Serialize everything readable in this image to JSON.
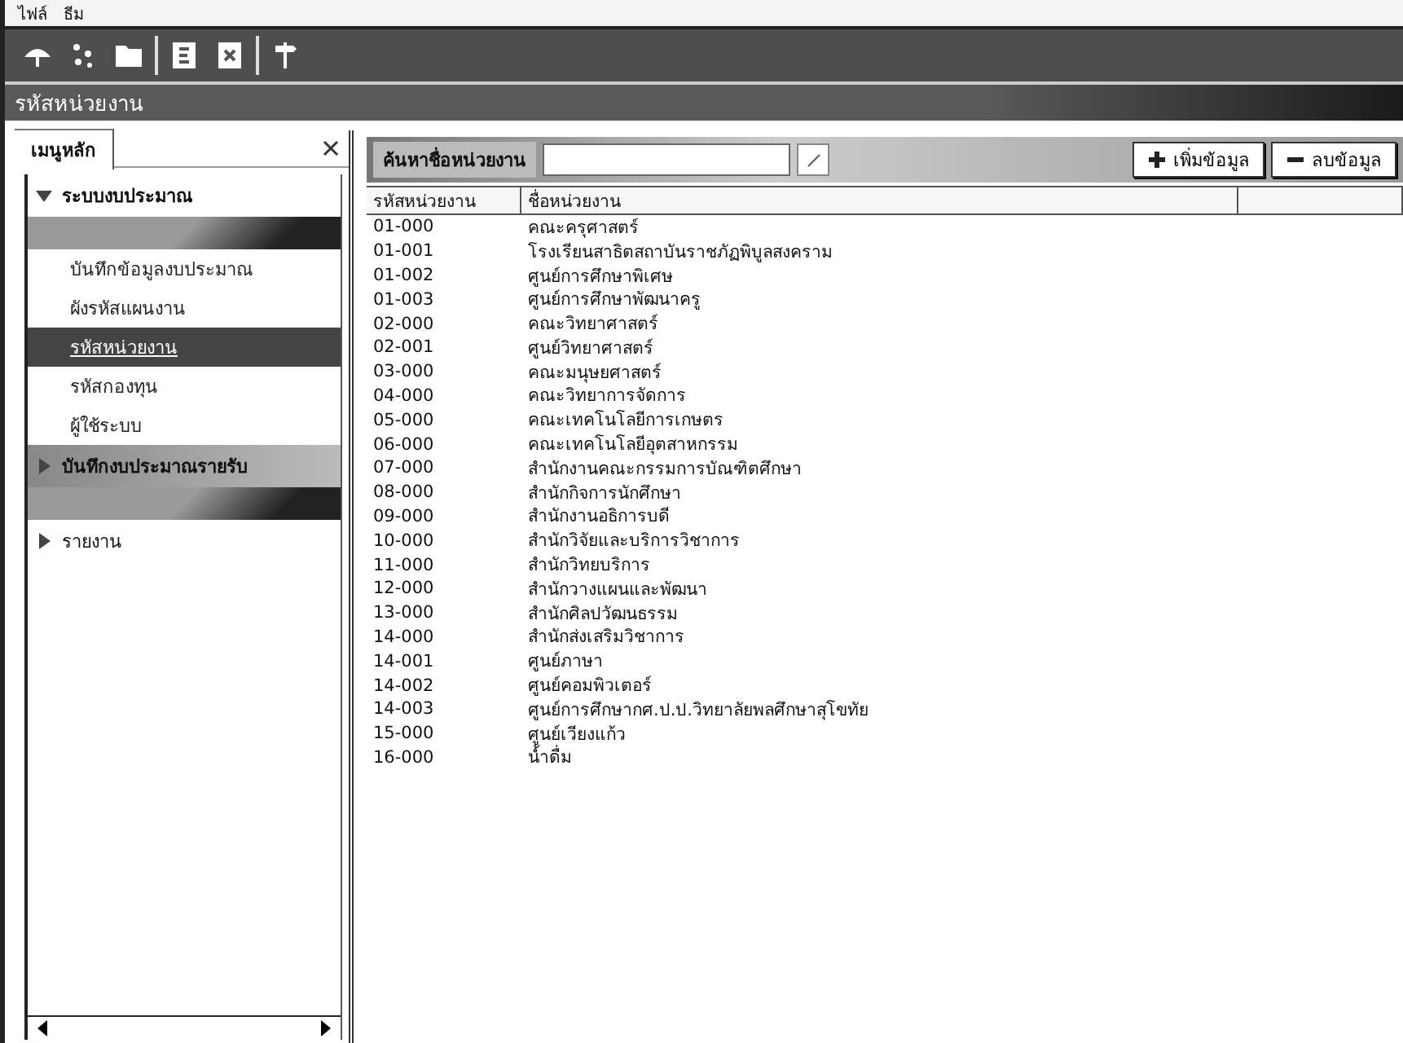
{
  "menu_bar": [
    "ไฟล์",
    "ธีม"
  ],
  "toolbar": {
    "buttons": [
      {
        "kind": "umbrella"
      },
      {
        "kind": "sparkle"
      },
      {
        "kind": "folder"
      },
      {
        "kind": "edit"
      },
      {
        "kind": "delete"
      },
      {
        "kind": "exit"
      }
    ]
  },
  "window": {
    "title": "รหัสหน่วยงาน"
  },
  "sidebar": {
    "tabs": [
      {
        "label": "เมนูหลัก",
        "selected": true
      }
    ],
    "groups": [
      {
        "label": "ระบบงบประมาณ",
        "expanded": true,
        "items": [
          {
            "label": "บันทึกข้อมูลงบประมาณ",
            "selected": false
          },
          {
            "label": "ผังรหัสแผนงาน",
            "selected": false
          },
          {
            "label": "รหัสหน่วยงาน",
            "selected": true
          },
          {
            "label": "รหัสกองทุน",
            "selected": false
          },
          {
            "label": "ผู้ใช้ระบบ",
            "selected": false
          }
        ]
      },
      {
        "label": "บันทึกงบประมาณรายรับ",
        "expanded": false
      },
      {
        "label": "รายงาน",
        "expanded": false
      }
    ]
  },
  "search": {
    "label": "ค้นหาชื่อหน่วยงาน"
  },
  "buttons": [
    {
      "kind": "add",
      "label": "เพิ่มข้อมูล"
    },
    {
      "kind": "remove",
      "label": "ลบข้อมูล"
    }
  ],
  "table": {
    "columns": [
      "รหัสหน่วยงาน",
      "ชื่อหน่วยงาน"
    ],
    "rows": [
      [
        "01-000",
        "คณะครุศาสตร์"
      ],
      [
        "01-001",
        "โรงเรียนสาธิตสถาบันราชภัฏพิบูลสงคราม"
      ],
      [
        "01-002",
        "ศูนย์การศึกษาพิเศษ"
      ],
      [
        "01-003",
        "ศูนย์การศึกษาพัฒนาครู"
      ],
      [
        "02-000",
        "คณะวิทยาศาสตร์"
      ],
      [
        "02-001",
        "ศูนย์วิทยาศาสตร์"
      ],
      [
        "03-000",
        "คณะมนุษยศาสตร์"
      ],
      [
        "04-000",
        "คณะวิทยาการจัดการ"
      ],
      [
        "05-000",
        "คณะเทคโนโลยีการเกษตร"
      ],
      [
        "06-000",
        "คณะเทคโนโลยีอุตสาหกรรม"
      ],
      [
        "07-000",
        "สำนักงานคณะกรรมการบัณฑิตศึกษา"
      ],
      [
        "08-000",
        "สำนักกิจการนักศึกษา"
      ],
      [
        "09-000",
        "สำนักงานอธิการบดี"
      ],
      [
        "10-000",
        "สำนักวิจัยและบริการวิชาการ"
      ],
      [
        "11-000",
        "สำนักวิทยบริการ"
      ],
      [
        "12-000",
        "สำนักวางแผนและพัฒนา"
      ],
      [
        "13-000",
        "สำนักศิลปวัฒนธรรม"
      ],
      [
        "14-000",
        "สำนักส่งเสริมวิชาการ"
      ],
      [
        "14-001",
        "ศูนย์ภาษา"
      ],
      [
        "14-002",
        "ศูนย์คอมพิวเตอร์"
      ],
      [
        "14-003",
        "ศูนย์การศึกษากศ.ป.ป.วิทยาลัยพลศึกษาสุโขทัย"
      ],
      [
        "15-000",
        "ศูนย์เวียงแก้ว"
      ],
      [
        "16-000",
        "น้ำดื่ม"
      ]
    ]
  }
}
